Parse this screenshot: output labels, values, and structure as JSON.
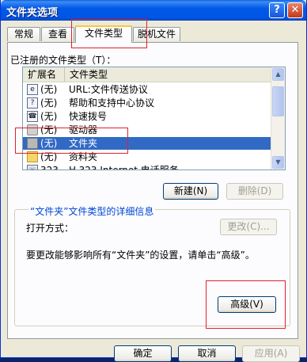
{
  "window": {
    "title": "文件夹选项"
  },
  "tabs": [
    "常规",
    "查看",
    "文件类型",
    "脱机文件"
  ],
  "panel": {
    "registered_label": "已注册的文件类型（T）：",
    "columns": [
      "扩展名",
      "文件类型"
    ],
    "rows": [
      {
        "ext": "(无)",
        "type": "URL:文件传送协议",
        "icon": "url-icon"
      },
      {
        "ext": "(无)",
        "type": "帮助和支持中心协议",
        "icon": "help-protocol-icon"
      },
      {
        "ext": "(无)",
        "type": "快速拨号",
        "icon": "speed-dial-icon"
      },
      {
        "ext": "(无)",
        "type": "驱动器",
        "icon": "drive-icon"
      },
      {
        "ext": "(无)",
        "type": "文件夹",
        "icon": "folder-icon",
        "selected": true
      },
      {
        "ext": "(无)",
        "type": "资料夹",
        "icon": "folder-icon"
      },
      {
        "ext": "323",
        "type": "H.323 Internet 电话服务",
        "icon": "h323-icon"
      }
    ],
    "new_button": "新建(N)",
    "delete_button": "删除(D)",
    "group_title": "“文件夹”文件类型的详细信息",
    "open_with_label": "打开方式：",
    "change_button": "更改(C)...",
    "description": "要更改能够影响所有“文件夹”的设置，请单击“高级”。",
    "advanced_button": "高级(V)"
  },
  "footer": {
    "ok": "确定",
    "cancel": "取消",
    "apply": "应用(A)"
  },
  "colors": {
    "selection": "#316ac5",
    "highlight_box": "#e2202c",
    "group_title": "#0046d5"
  }
}
